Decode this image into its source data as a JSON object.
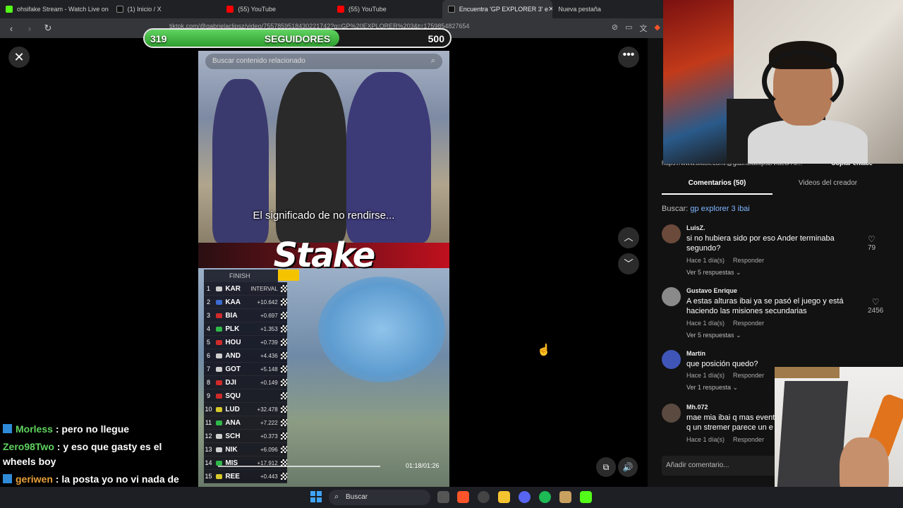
{
  "browser": {
    "tabs": [
      {
        "title": "ohsifake Stream - Watch Live on",
        "color": "#53fc18",
        "active": false
      },
      {
        "title": "(1) Inicio / X",
        "color": "#111111",
        "active": false
      },
      {
        "title": "(55) YouTube",
        "color": "#ff0000",
        "active": false
      },
      {
        "title": "(55) YouTube",
        "color": "#ff0000",
        "active": false
      },
      {
        "title": "Encuentra 'GP EXPLORER 3' e",
        "color": "#111111",
        "active": true
      },
      {
        "title": "Nueva pestaña",
        "color": "#777777",
        "active": false
      }
    ],
    "url": "tiktok.com/@gabrielaclipsz/video/7557859518430221742?q=GP%20EXPLORER%203&t=1759854827654"
  },
  "followers": {
    "current": "319",
    "label": "SEGUIDORES",
    "goal": "500",
    "progress": 0.638
  },
  "video": {
    "search_placeholder": "Buscar contenido relacionado",
    "caption": "El significado de no rendirse...",
    "sponsor": "Stake",
    "finish_label": "FINISH",
    "standings": [
      {
        "pos": "1",
        "driver": "KAR",
        "gap": "INTERVAL",
        "color": "#cfcfcf"
      },
      {
        "pos": "2",
        "driver": "KAA",
        "gap": "+10.642",
        "color": "#3a6bd0"
      },
      {
        "pos": "3",
        "driver": "BIA",
        "gap": "+0.697",
        "color": "#d02a2a"
      },
      {
        "pos": "4",
        "driver": "PLK",
        "gap": "+1.353",
        "color": "#2fb84a"
      },
      {
        "pos": "5",
        "driver": "HOU",
        "gap": "+0.739",
        "color": "#d02a2a"
      },
      {
        "pos": "6",
        "driver": "AND",
        "gap": "+4.436",
        "color": "#cfcfcf"
      },
      {
        "pos": "7",
        "driver": "GOT",
        "gap": "+5.148",
        "color": "#cfcfcf"
      },
      {
        "pos": "8",
        "driver": "DJI",
        "gap": "+0.149",
        "color": "#d02a2a"
      },
      {
        "pos": "9",
        "driver": "SQU",
        "gap": "",
        "color": "#d02a2a"
      },
      {
        "pos": "10",
        "driver": "LUD",
        "gap": "+32.478",
        "color": "#d8c92a"
      },
      {
        "pos": "11",
        "driver": "ANA",
        "gap": "+7.222",
        "color": "#2fb84a"
      },
      {
        "pos": "12",
        "driver": "SCH",
        "gap": "+0.373",
        "color": "#cfcfcf"
      },
      {
        "pos": "13",
        "driver": "NIK",
        "gap": "+6.096",
        "color": "#cfcfcf"
      },
      {
        "pos": "14",
        "driver": "MIS",
        "gap": "+17.912",
        "color": "#2fb84a"
      },
      {
        "pos": "15",
        "driver": "REE",
        "gap": "+0.443",
        "color": "#d8c92a"
      }
    ],
    "timecode": "01:18/01:26"
  },
  "panel": {
    "url_text": "https://www.tiktok.com/@gabrielaclipsz/video/75...",
    "copy_link": "Copiar enlace",
    "tabs": [
      "Comentarios (50)",
      "Videos del creador"
    ],
    "search_prefix": "Buscar:",
    "search_term": "gp explorer 3 ibai",
    "comments": [
      {
        "name": "LuisZ.",
        "text": "si no hubiera sido por eso Ander terminaba segundo?",
        "time": "Hace 1 día(s)",
        "reply": "Responder",
        "replies": "Ver 5 respuestas",
        "likes": "79",
        "avatar": "#6b4a3c"
      },
      {
        "name": "Gustavo Enrique",
        "text": "A estas alturas ibai ya se pasó el juego y está haciendo las misiones secundarias",
        "time": "Hace 1 día(s)",
        "reply": "Responder",
        "replies": "Ver 5 respuestas",
        "likes": "2456",
        "avatar": "#8a8a8a"
      },
      {
        "name": "Martín",
        "text": "que posición quedo?",
        "time": "Hace 1 día(s)",
        "reply": "Responder",
        "replies": "Ver 1 respuesta",
        "likes": "",
        "avatar": "#3f56b8"
      },
      {
        "name": "Mh.072",
        "text": "mae mia ibai q mas event q un stremer parece un e",
        "time": "Hace 1 día(s)",
        "reply": "Responder",
        "replies": "",
        "likes": "",
        "avatar": "#5a4a40"
      }
    ],
    "add_comment": "Añadir comentario..."
  },
  "chat": [
    {
      "user": "Morless",
      "message": ": pero no llegue"
    },
    {
      "user": "Zero98Two",
      "message": ": y eso que gasty es el wheels boy"
    },
    {
      "user": "geriwen",
      "message": ": la posta yo no vi nada de nada"
    }
  ],
  "taskbar": {
    "search_label": "Buscar"
  }
}
